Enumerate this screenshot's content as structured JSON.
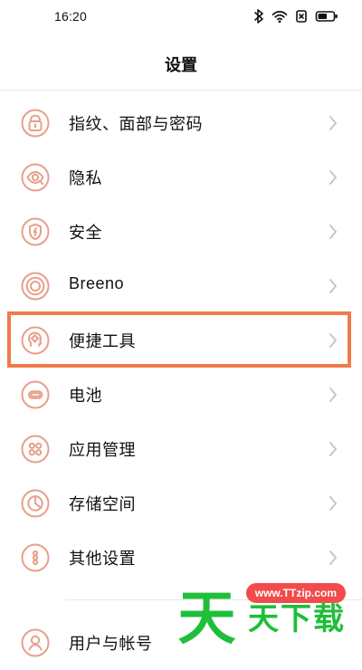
{
  "status_bar": {
    "time": "16:20"
  },
  "header": {
    "title": "设置"
  },
  "colors": {
    "accent": "#E7A08A",
    "highlight": "#F07A4A",
    "divider": "#E9E9E9",
    "watermark_green": "#1FBF3A",
    "watermark_badge": "#F24B4B"
  },
  "settings": {
    "items": [
      {
        "label": "指纹、面部与密码",
        "icon": "lock-icon"
      },
      {
        "label": "隐私",
        "icon": "privacy-eye-icon"
      },
      {
        "label": "安全",
        "icon": "shield-bolt-icon"
      },
      {
        "label": "Breeno",
        "icon": "breeno-rings-icon"
      },
      {
        "label": "便捷工具",
        "icon": "head-tools-icon"
      },
      {
        "label": "电池",
        "icon": "battery-icon"
      },
      {
        "label": "应用管理",
        "icon": "apps-grid-icon"
      },
      {
        "label": "存储空间",
        "icon": "storage-pie-icon"
      },
      {
        "label": "其他设置",
        "icon": "more-dots-icon"
      }
    ],
    "bottom_item": {
      "label": "用户与帐号",
      "icon": "user-icon"
    }
  },
  "watermark": {
    "badge": "www.TTzip.com",
    "text_big": "天",
    "text_small": "天下载"
  }
}
